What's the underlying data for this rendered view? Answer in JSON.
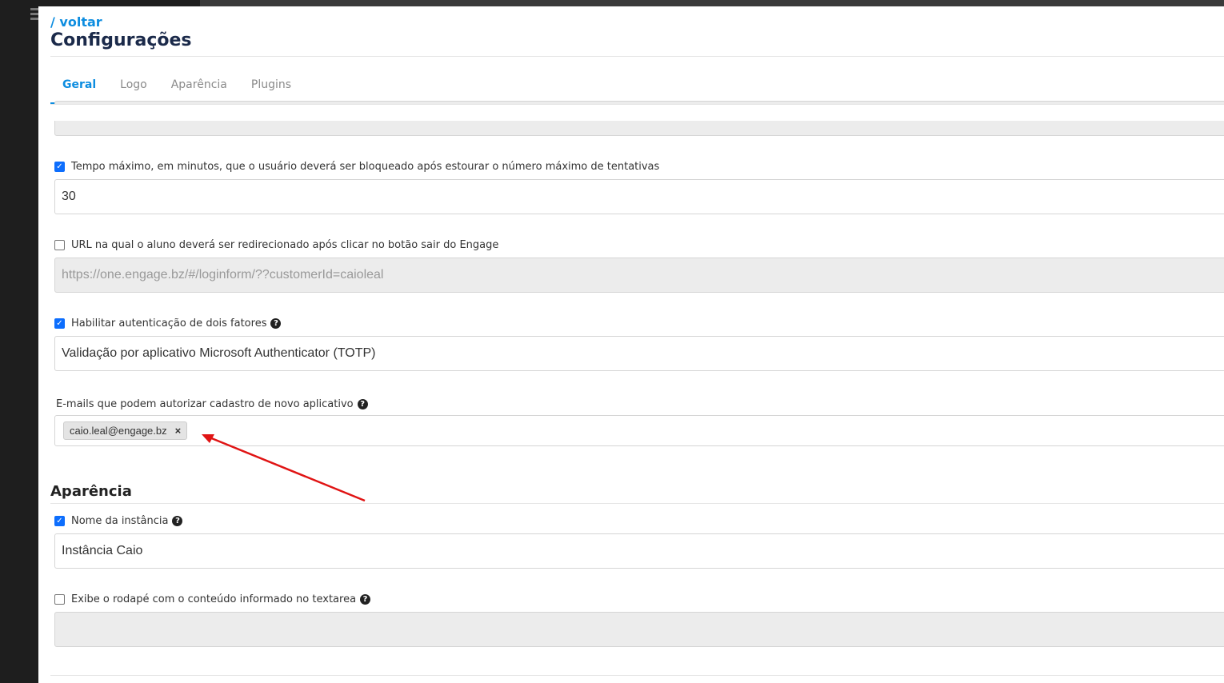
{
  "header": {
    "back_link": "/ voltar",
    "title": "Configurações"
  },
  "tabs": [
    {
      "label": "Geral",
      "active": true
    },
    {
      "label": "Logo",
      "active": false
    },
    {
      "label": "Aparência",
      "active": false
    },
    {
      "label": "Plugins",
      "active": false
    }
  ],
  "general": {
    "lock_time": {
      "checked": true,
      "label": "Tempo máximo, em minutos, que o usuário deverá ser bloqueado após estourar o número máximo de tentativas",
      "value": "30"
    },
    "logout_url": {
      "checked": false,
      "label": "URL na qual o aluno deverá ser redirecionado após clicar no botão sair do Engage",
      "placeholder": "https://one.engage.bz/#/loginform/??customerId=caioleal"
    },
    "two_factor": {
      "checked": true,
      "label": "Habilitar autenticação de dois fatores",
      "value": "Validação por aplicativo Microsoft Authenticator (TOTP)"
    },
    "authorized_emails": {
      "label": "E-mails que podem autorizar cadastro de novo aplicativo",
      "tags": [
        "caio.leal@engage.bz"
      ],
      "remove_symbol": "×"
    }
  },
  "appearance": {
    "section_title": "Aparência",
    "instance_name": {
      "checked": true,
      "label": "Nome da instância",
      "value": "Instância Caio"
    },
    "footer": {
      "checked": false,
      "label": "Exibe o rodapé com o conteúdo informado no textarea"
    }
  },
  "icons": {
    "check_glyph": "✓",
    "help_glyph": "?"
  },
  "colors": {
    "accent": "#0d8de0",
    "annotation_arrow": "#e01414"
  }
}
